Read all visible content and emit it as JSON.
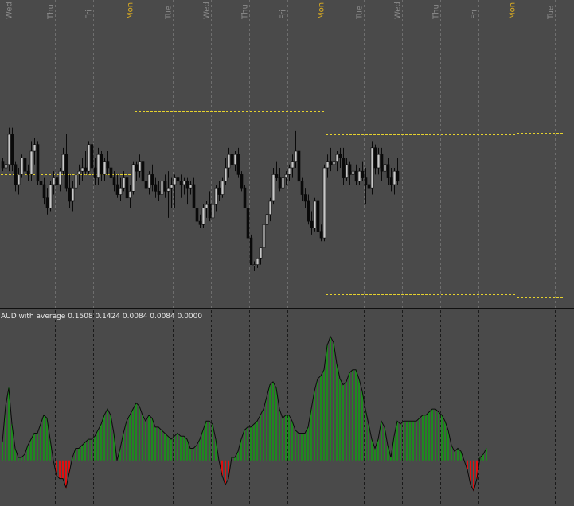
{
  "colors": {
    "background": "#4a4a4a",
    "grid": "#6e6e6e",
    "day_label": "#8c8c8c",
    "week_label": "#e0b020",
    "week_line": "#e0b020",
    "level_line": "#e6d22e",
    "bull_candle": "#c8c8c8",
    "bear_candle": "#0a0a0a",
    "wick": "#0a0a0a",
    "panel_divider": "#101010",
    "indicator_positive": "#1f8a1f",
    "indicator_negative": "#e01010",
    "indicator_line": "#0a0a0a",
    "indicator_label": "#e6e6e6"
  },
  "chart_data": [
    {
      "type": "candlestick",
      "x_axis_labels": [
        {
          "text": "Wed",
          "major": false,
          "index": 4
        },
        {
          "text": "Thu",
          "major": false,
          "index": 17
        },
        {
          "text": "Fri",
          "major": false,
          "index": 29
        },
        {
          "text": "Mon",
          "major": true,
          "index": 42
        },
        {
          "text": "Tue",
          "major": false,
          "index": 54
        },
        {
          "text": "Wed",
          "major": false,
          "index": 66
        },
        {
          "text": "Thu",
          "major": false,
          "index": 78
        },
        {
          "text": "Fri",
          "major": false,
          "index": 90
        },
        {
          "text": "Mon",
          "major": true,
          "index": 102
        },
        {
          "text": "Tue",
          "major": false,
          "index": 114
        },
        {
          "text": "Wed",
          "major": false,
          "index": 126
        },
        {
          "text": "Thu",
          "major": false,
          "index": 138
        },
        {
          "text": "Fri",
          "major": false,
          "index": 150
        },
        {
          "text": "Mon",
          "major": true,
          "index": 162
        },
        {
          "text": "Tue",
          "major": false,
          "index": 174
        }
      ],
      "levels": [
        {
          "from": 0,
          "to": 42,
          "value": 27
        },
        {
          "from": 42,
          "to": 102,
          "value": 46
        },
        {
          "from": 42,
          "to": 102,
          "value": 10
        },
        {
          "from": 102,
          "to": 162,
          "value": 39
        },
        {
          "from": 102,
          "to": 162,
          "value": -9
        },
        {
          "from": 162,
          "to": 177,
          "value": 39.5
        },
        {
          "from": 162,
          "to": 177,
          "value": -9.5
        }
      ],
      "ylim": [
        -12,
        75
      ],
      "ohlc": [
        [
          31,
          32,
          28,
          29
        ],
        [
          29,
          31,
          27,
          30
        ],
        [
          30,
          41,
          28,
          39
        ],
        [
          39,
          41,
          28,
          30
        ],
        [
          30,
          31,
          22,
          24
        ],
        [
          24,
          29,
          21,
          27
        ],
        [
          27,
          33,
          26,
          32
        ],
        [
          32,
          35,
          27,
          28
        ],
        [
          28,
          30,
          25,
          27
        ],
        [
          27,
          37,
          25,
          34
        ],
        [
          34,
          38,
          30,
          36
        ],
        [
          36,
          37,
          24,
          25
        ],
        [
          25,
          27,
          22,
          24
        ],
        [
          24,
          26,
          18,
          20
        ],
        [
          20,
          23,
          15,
          17
        ],
        [
          17,
          25,
          16,
          24
        ],
        [
          24,
          28,
          21,
          26
        ],
        [
          26,
          27,
          22,
          24
        ],
        [
          24,
          29,
          22,
          28
        ],
        [
          28,
          35,
          27,
          33
        ],
        [
          33,
          39,
          22,
          23
        ],
        [
          23,
          27,
          17,
          19
        ],
        [
          19,
          25,
          16,
          23
        ],
        [
          23,
          29,
          21,
          27
        ],
        [
          27,
          30,
          24,
          28
        ],
        [
          28,
          32,
          25,
          29
        ],
        [
          29,
          34,
          27,
          28
        ],
        [
          28,
          37,
          27,
          36
        ],
        [
          36,
          37,
          28,
          29
        ],
        [
          29,
          32,
          24,
          26
        ],
        [
          26,
          35,
          24,
          33
        ],
        [
          33,
          34,
          25,
          27
        ],
        [
          27,
          32,
          25,
          31
        ],
        [
          31,
          34,
          27,
          29
        ],
        [
          29,
          32,
          24,
          26
        ],
        [
          26,
          28,
          22,
          24
        ],
        [
          24,
          27,
          20,
          21
        ],
        [
          21,
          26,
          19,
          23
        ],
        [
          23,
          28,
          22,
          26
        ],
        [
          26,
          27,
          19,
          20
        ],
        [
          20,
          24,
          17,
          22
        ],
        [
          22,
          31,
          21,
          30
        ],
        [
          30,
          31,
          25,
          28
        ],
        [
          28,
          33,
          26,
          31
        ],
        [
          31,
          32,
          24,
          25
        ],
        [
          25,
          29,
          22,
          23
        ],
        [
          23,
          28,
          21,
          27
        ],
        [
          27,
          30,
          22,
          24
        ],
        [
          24,
          26,
          20,
          22
        ],
        [
          22,
          25,
          19,
          21
        ],
        [
          21,
          27,
          18,
          25
        ],
        [
          25,
          27,
          20,
          22
        ],
        [
          22,
          28,
          14,
          23
        ],
        [
          23,
          26,
          17,
          24
        ],
        [
          24,
          27,
          17,
          26
        ],
        [
          26,
          28,
          20,
          25
        ],
        [
          25,
          27,
          20,
          24
        ],
        [
          24,
          26,
          21,
          25
        ],
        [
          25,
          26,
          18,
          23
        ],
        [
          23,
          25,
          21,
          24
        ],
        [
          24,
          26,
          18,
          17
        ],
        [
          17,
          18,
          12,
          13
        ],
        [
          13,
          15,
          11,
          12
        ],
        [
          12,
          18,
          11,
          17
        ],
        [
          17,
          19,
          14,
          18
        ],
        [
          18,
          22,
          13,
          14
        ],
        [
          14,
          20,
          12,
          18
        ],
        [
          18,
          24,
          16,
          23
        ],
        [
          23,
          25,
          19,
          21
        ],
        [
          21,
          26,
          20,
          25
        ],
        [
          25,
          32,
          24,
          29
        ],
        [
          29,
          35,
          26,
          33
        ],
        [
          33,
          34,
          28,
          30
        ],
        [
          30,
          34,
          28,
          33
        ],
        [
          33,
          35,
          26,
          27
        ],
        [
          27,
          28,
          22,
          23
        ],
        [
          23,
          24,
          17,
          17
        ],
        [
          17,
          17,
          8,
          8
        ],
        [
          8,
          9,
          0,
          0
        ],
        [
          0,
          1,
          -2,
          0
        ],
        [
          0,
          1,
          -1,
          2
        ],
        [
          2,
          5,
          0,
          5
        ],
        [
          5,
          12,
          3,
          12
        ],
        [
          12,
          16,
          10,
          15
        ],
        [
          15,
          20,
          13,
          19
        ],
        [
          19,
          29,
          18,
          27
        ],
        [
          27,
          31,
          25,
          26
        ],
        [
          26,
          29,
          22,
          23
        ],
        [
          23,
          27,
          22,
          26
        ],
        [
          26,
          28,
          24,
          27
        ],
        [
          27,
          30,
          25,
          29
        ],
        [
          29,
          33,
          26,
          31
        ],
        [
          31,
          40,
          29,
          34
        ],
        [
          34,
          35,
          24,
          25
        ],
        [
          25,
          26,
          19,
          21
        ],
        [
          21,
          23,
          17,
          19
        ],
        [
          19,
          21,
          12,
          13
        ],
        [
          13,
          16,
          9,
          11
        ],
        [
          11,
          20,
          10,
          19
        ],
        [
          19,
          20,
          9,
          10
        ],
        [
          10,
          12,
          7,
          8
        ],
        [
          8,
          30,
          7,
          29
        ],
        [
          29,
          33,
          26,
          31
        ],
        [
          31,
          35,
          28,
          30
        ],
        [
          30,
          33,
          27,
          31
        ],
        [
          31,
          34,
          28,
          33
        ],
        [
          33,
          35,
          29,
          32
        ],
        [
          32,
          35,
          24,
          26
        ],
        [
          26,
          32,
          25,
          30
        ],
        [
          30,
          31,
          24,
          27
        ],
        [
          27,
          29,
          24,
          28
        ],
        [
          28,
          30,
          24,
          25
        ],
        [
          25,
          29,
          24,
          28
        ],
        [
          28,
          31,
          25,
          26
        ],
        [
          26,
          29,
          18,
          24
        ],
        [
          24,
          28,
          22,
          23
        ],
        [
          23,
          37,
          21,
          35
        ],
        [
          35,
          36,
          27,
          29
        ],
        [
          29,
          35,
          27,
          33
        ],
        [
          33,
          35,
          25,
          28
        ],
        [
          28,
          37,
          26,
          30
        ],
        [
          30,
          32,
          24,
          26
        ],
        [
          26,
          29,
          22,
          24
        ],
        [
          24,
          29,
          21,
          28
        ],
        [
          28,
          32,
          24,
          25
        ]
      ]
    },
    {
      "type": "histogram",
      "label": "AUD with average 0.1508 0.1424 0.0084 0.0084 0.0000",
      "ylim": [
        -0.07,
        0.235
      ],
      "values": [
        0.03,
        0.09,
        0.12,
        0.06,
        0.02,
        0.005,
        0.005,
        0.01,
        0.025,
        0.035,
        0.045,
        0.045,
        0.06,
        0.075,
        0.07,
        0.035,
        0.0,
        -0.025,
        -0.03,
        -0.03,
        -0.045,
        -0.02,
        0.005,
        0.02,
        0.02,
        0.025,
        0.03,
        0.035,
        0.035,
        0.04,
        0.05,
        0.06,
        0.075,
        0.085,
        0.075,
        0.045,
        0.0,
        0.02,
        0.045,
        0.065,
        0.075,
        0.085,
        0.095,
        0.09,
        0.075,
        0.065,
        0.075,
        0.07,
        0.055,
        0.055,
        0.05,
        0.045,
        0.04,
        0.035,
        0.04,
        0.045,
        0.04,
        0.04,
        0.035,
        0.02,
        0.02,
        0.025,
        0.035,
        0.05,
        0.065,
        0.065,
        0.06,
        0.035,
        0.0,
        -0.025,
        -0.04,
        -0.03,
        0.005,
        0.005,
        0.015,
        0.035,
        0.05,
        0.055,
        0.055,
        0.06,
        0.065,
        0.075,
        0.085,
        0.105,
        0.125,
        0.13,
        0.12,
        0.085,
        0.07,
        0.075,
        0.075,
        0.065,
        0.05,
        0.045,
        0.045,
        0.045,
        0.055,
        0.085,
        0.115,
        0.135,
        0.14,
        0.15,
        0.19,
        0.205,
        0.195,
        0.16,
        0.135,
        0.125,
        0.13,
        0.145,
        0.15,
        0.15,
        0.135,
        0.115,
        0.085,
        0.06,
        0.035,
        0.02,
        0.035,
        0.065,
        0.055,
        0.025,
        0.005,
        0.04,
        0.065,
        0.06,
        0.065,
        0.065,
        0.065,
        0.065,
        0.065,
        0.07,
        0.075,
        0.075,
        0.08,
        0.085,
        0.085,
        0.08,
        0.075,
        0.065,
        0.05,
        0.025,
        0.015,
        0.02,
        0.015,
        0.0,
        -0.015,
        -0.04,
        -0.05,
        -0.03,
        0.005,
        0.01,
        0.02
      ]
    }
  ]
}
